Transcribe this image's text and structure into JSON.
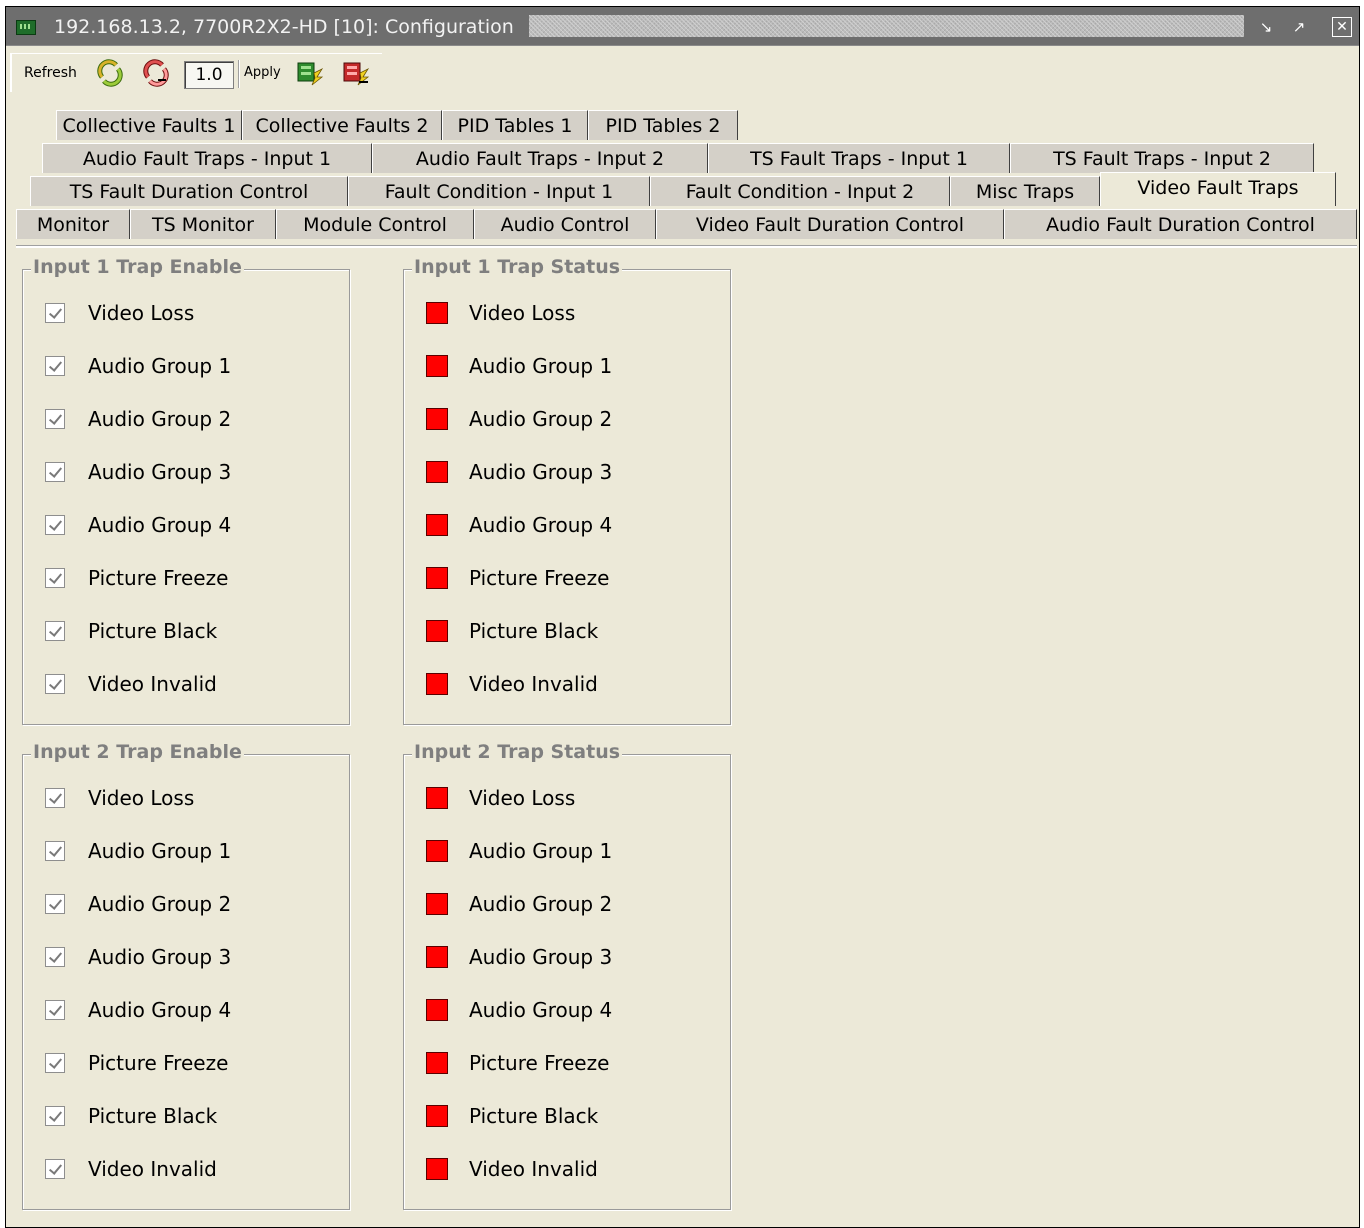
{
  "window": {
    "title": "192.168.13.2, 7700R2X2-HD  [10]: Configuration",
    "controls": [
      "restore-icon",
      "maximize-icon",
      "close-icon"
    ]
  },
  "toolbar": {
    "refresh_label": "Refresh",
    "zoom_value": "1.0",
    "apply_label": "Apply",
    "icons": [
      "refresh-green-icon",
      "refresh-red-icon",
      "apply-green-icon",
      "apply-red-icon"
    ]
  },
  "tabs": {
    "row1": [
      "Collective Faults 1",
      "Collective Faults 2",
      "PID Tables 1",
      "PID Tables 2"
    ],
    "row2": [
      "Audio Fault Traps - Input 1",
      "Audio Fault Traps - Input 2",
      "TS Fault Traps - Input 1",
      "TS Fault Traps - Input 2"
    ],
    "row3": [
      "TS Fault Duration Control",
      "Fault Condition - Input 1",
      "Fault Condition - Input 2",
      "Misc Traps",
      "Video Fault Traps"
    ],
    "row4": [
      "Monitor",
      "TS Monitor",
      "Module Control",
      "Audio Control",
      "Video Fault Duration Control",
      "Audio Fault Duration Control"
    ],
    "active": "Video Fault Traps"
  },
  "groups": {
    "input1_enable": {
      "title": "Input 1 Trap Enable",
      "items": [
        "Video Loss",
        "Audio Group 1",
        "Audio Group 2",
        "Audio Group 3",
        "Audio Group 4",
        "Picture Freeze",
        "Picture Black",
        "Video Invalid"
      ],
      "checked": true
    },
    "input1_status": {
      "title": "Input 1 Trap Status",
      "items": [
        "Video Loss",
        "Audio Group 1",
        "Audio Group 2",
        "Audio Group 3",
        "Audio Group 4",
        "Picture Freeze",
        "Picture Black",
        "Video Invalid"
      ],
      "status_color": "#ff0000"
    },
    "input2_enable": {
      "title": "Input 2 Trap Enable",
      "items": [
        "Video Loss",
        "Audio Group 1",
        "Audio Group 2",
        "Audio Group 3",
        "Audio Group 4",
        "Picture Freeze",
        "Picture Black",
        "Video Invalid"
      ],
      "checked": true
    },
    "input2_status": {
      "title": "Input 2 Trap Status",
      "items": [
        "Video Loss",
        "Audio Group 1",
        "Audio Group 2",
        "Audio Group 3",
        "Audio Group 4",
        "Picture Freeze",
        "Picture Black",
        "Video Invalid"
      ],
      "status_color": "#ff0000"
    }
  }
}
